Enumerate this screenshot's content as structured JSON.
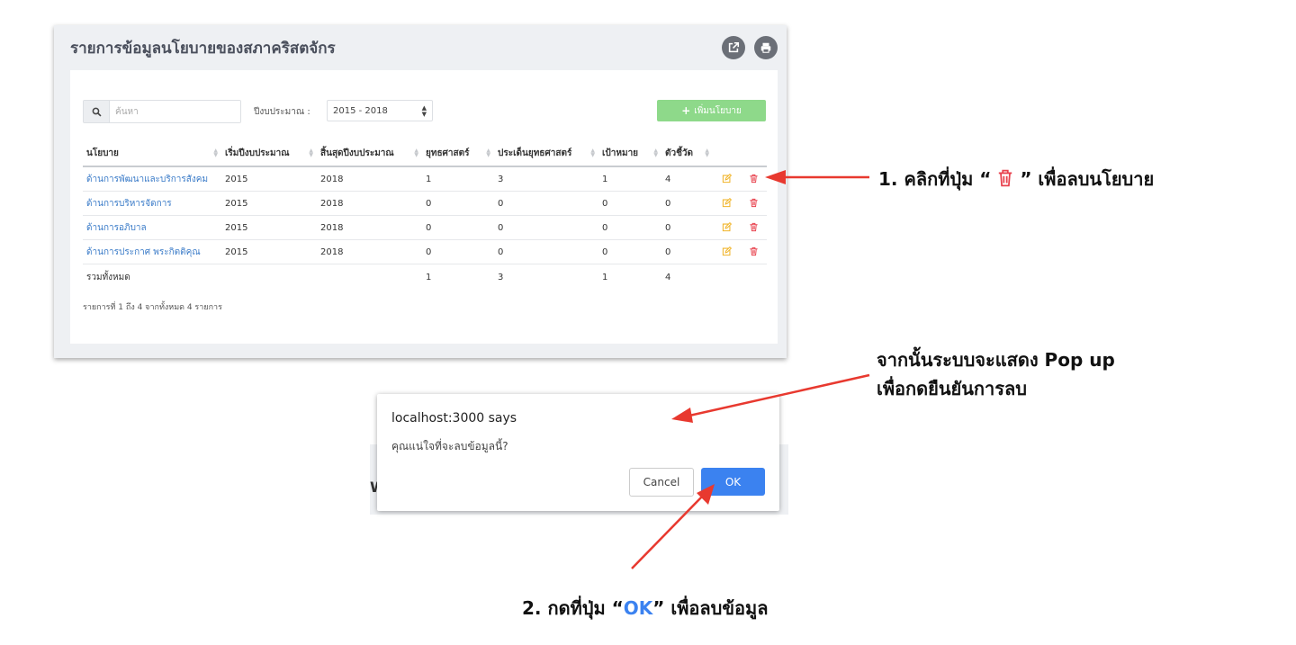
{
  "panel": {
    "title": "รายการข้อมูลนโยบายของสภาคริสตจักร"
  },
  "toolbar": {
    "search_placeholder": "ค้นหา",
    "year_label": "ปีงบประมาณ :",
    "year_value": "2015 - 2018",
    "add_button": "เพิ่มนโยบาย"
  },
  "table": {
    "headers": [
      "นโยบาย",
      "เริ่มปีงบประมาณ",
      "สิ้นสุดปีงบประมาณ",
      "ยุทธศาสตร์",
      "ประเด็นยุทธศาสตร์",
      "เป้าหมาย",
      "ตัวชี้วัด"
    ],
    "rows": [
      {
        "name": "ด้านการพัฒนาและบริการสังคม",
        "start": "2015",
        "end": "2018",
        "strategy": "1",
        "issue": "3",
        "target": "1",
        "indicator": "4"
      },
      {
        "name": "ด้านการบริหารจัดการ",
        "start": "2015",
        "end": "2018",
        "strategy": "0",
        "issue": "0",
        "target": "0",
        "indicator": "0"
      },
      {
        "name": "ด้านการอภิบาล",
        "start": "2015",
        "end": "2018",
        "strategy": "0",
        "issue": "0",
        "target": "0",
        "indicator": "0"
      },
      {
        "name": "ด้านการประกาศ พระกิตติคุณ",
        "start": "2015",
        "end": "2018",
        "strategy": "0",
        "issue": "0",
        "target": "0",
        "indicator": "0"
      }
    ],
    "total": {
      "label": "รวมทั้งหมด",
      "strategy": "1",
      "issue": "3",
      "target": "1",
      "indicator": "4"
    },
    "info": "รายการที่ 1 ถึง 4 จากทั้งหมด 4 รายการ"
  },
  "dialog": {
    "title": "localhost:3000 says",
    "message": "คุณแน่ใจที่จะลบข้อมูลนี้?",
    "cancel": "Cancel",
    "ok": "OK"
  },
  "annotations": {
    "step1_prefix": "1. คลิกที่ปุ่ม “",
    "step1_suffix": "” เพื่อลบนโยบาย",
    "step2_line1": "จากนั้นระบบจะแสดง Pop up",
    "step2_line2": "เพื่อกดยืนยันการลบ",
    "step3_prefix": "2. กดที่ปุ่ม “",
    "step3_ok": "OK",
    "step3_suffix": "” เพื่อลบข้อมูล"
  },
  "colors": {
    "accent_blue": "#3b82f0",
    "delete_red": "#e8424e",
    "edit_orange": "#f0b429",
    "add_green": "#8ed98a",
    "arrow_red": "#e8392f"
  }
}
